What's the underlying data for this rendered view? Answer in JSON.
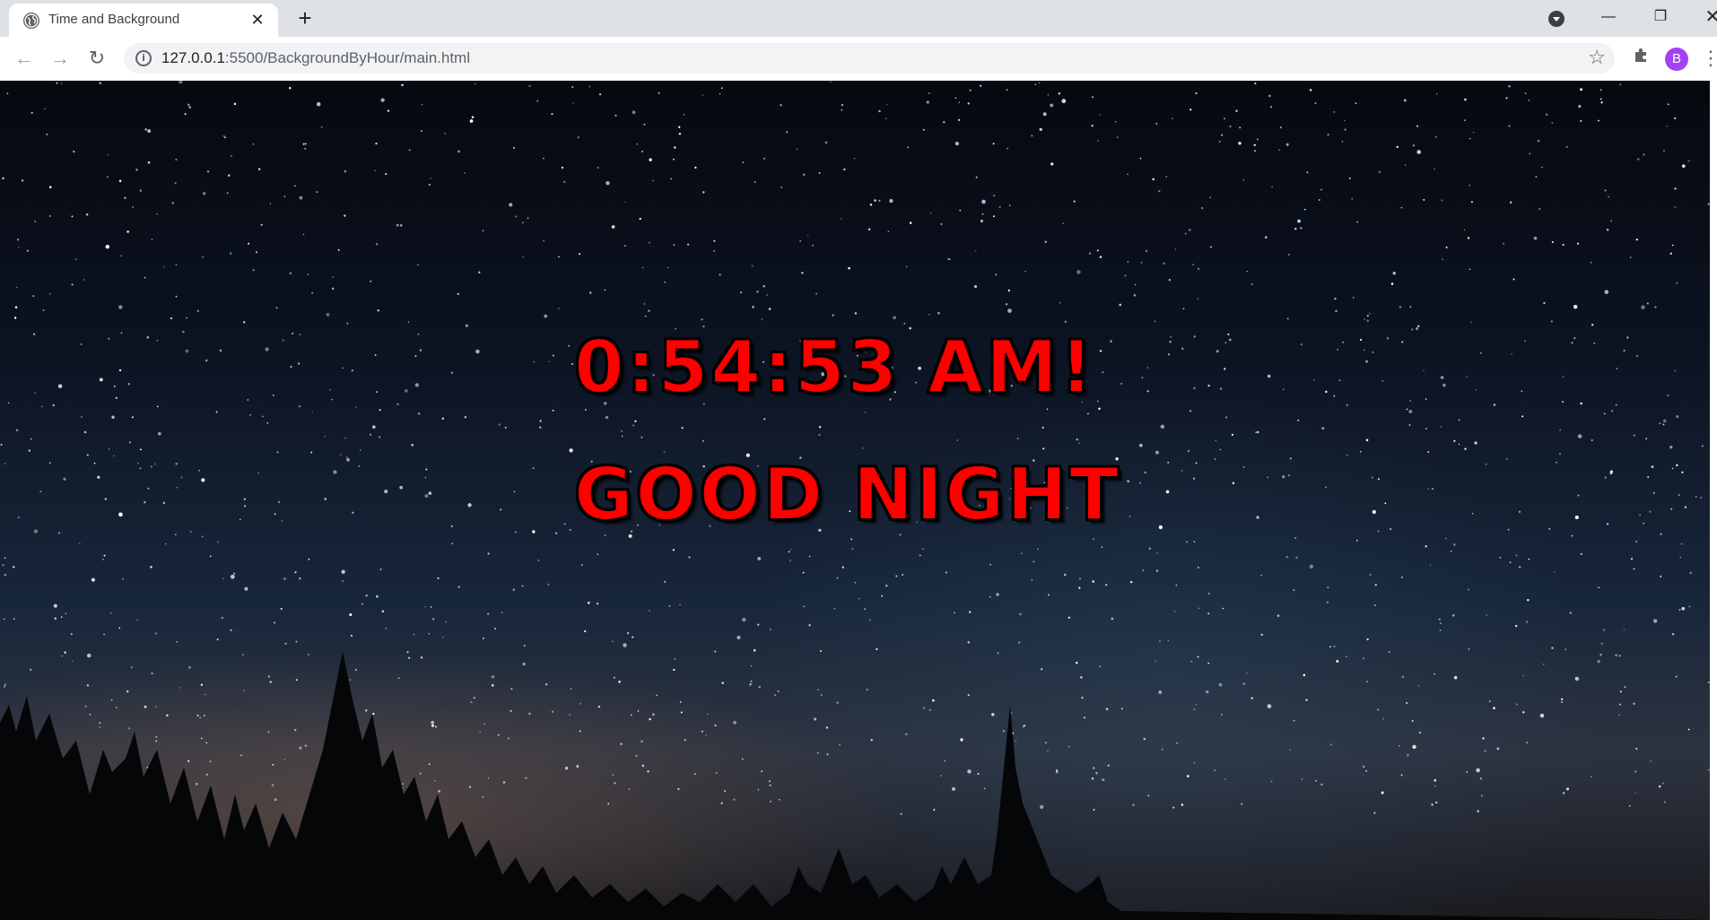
{
  "browser": {
    "tab": {
      "title": "Time and Background",
      "close_glyph": "✕",
      "favicon": "globe-icon"
    },
    "new_tab_glyph": "+",
    "window_controls": {
      "minimize": "—",
      "maximize": "❐",
      "close": "✕"
    },
    "address": {
      "host": "127.0.0.1",
      "path": ":5500/BackgroundByHour/main.html"
    },
    "toolbar": {
      "back": "←",
      "forward": "→",
      "reload": "↻",
      "star": "☆",
      "extensions": "✦",
      "menu": "⋮"
    },
    "profile_initial": "B"
  },
  "page": {
    "time": "0:54:53 AM!",
    "greeting": "GOOD NIGHT"
  },
  "colors": {
    "text": "#ff0000",
    "avatar": "#a142f4"
  }
}
